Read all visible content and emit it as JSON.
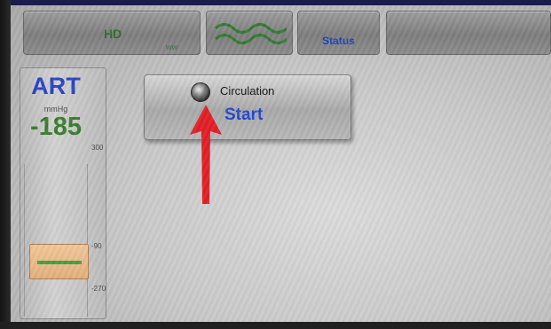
{
  "tabs": {
    "hd": {
      "label": "HD",
      "sub_label": "WW"
    },
    "wave": {
      "icon": "wave-icon"
    },
    "status": {
      "label": "Status"
    },
    "blank": {
      "label": ""
    }
  },
  "art": {
    "title": "ART",
    "unit": "mmHg",
    "value": "-185",
    "ticks": [
      "300",
      "-90",
      "-270"
    ]
  },
  "circulation": {
    "label": "Circulation",
    "action": "Start",
    "led": "indicator-led"
  },
  "annotation": {
    "icon": "red-arrow-icon"
  },
  "colors": {
    "accent_blue": "#2247cf",
    "value_green": "#3a7d2e",
    "limit_orange": "#e4b07c",
    "arrow_red": "#e21f26"
  }
}
